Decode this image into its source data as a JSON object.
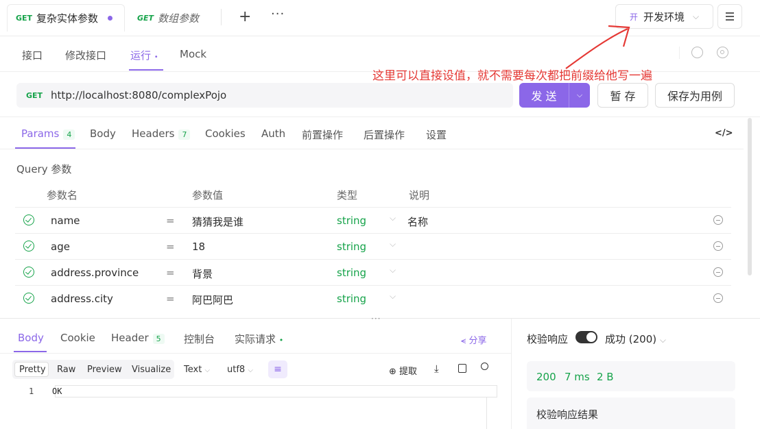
{
  "tabs": [
    {
      "method": "GET",
      "label": "复杂实体参数"
    },
    {
      "method": "GET",
      "label": "数组参数"
    }
  ],
  "env": {
    "badge": "开",
    "label": "开发环境"
  },
  "subnav": [
    "接口",
    "修改接口",
    "运行",
    "Mock"
  ],
  "annotation": "这里可以直接设值，就不需要每次都把前缀给他写一遍",
  "request": {
    "method": "GET",
    "url": "http://localhost:8080/complexPojo",
    "send": "发 送",
    "save": "暂 存",
    "save_case": "保存为用例"
  },
  "param_tabs": [
    {
      "label": "Params",
      "count": "4"
    },
    {
      "label": "Body"
    },
    {
      "label": "Headers",
      "count": "7"
    },
    {
      "label": "Cookies"
    },
    {
      "label": "Auth"
    },
    {
      "label": "前置操作"
    },
    {
      "label": "后置操作"
    },
    {
      "label": "设置"
    }
  ],
  "query": {
    "title": "Query 参数",
    "headers": [
      "参数名",
      "参数值",
      "类型",
      "说明"
    ],
    "rows": [
      {
        "name": "name",
        "eq": "=",
        "value": "猜猜我是谁",
        "type": "string",
        "desc": "名称"
      },
      {
        "name": "age",
        "eq": "=",
        "value": "18",
        "type": "string",
        "desc": ""
      },
      {
        "name": "address.province",
        "eq": "=",
        "value": "背景",
        "type": "string",
        "desc": ""
      },
      {
        "name": "address.city",
        "eq": "=",
        "value": "阿巴阿巴",
        "type": "string",
        "desc": ""
      }
    ]
  },
  "response_tabs": [
    {
      "label": "Body"
    },
    {
      "label": "Cookie"
    },
    {
      "label": "Header",
      "count": "5"
    },
    {
      "label": "控制台"
    },
    {
      "label": "实际请求"
    }
  ],
  "share": "分享",
  "view_tabs": [
    "Pretty",
    "Raw",
    "Preview",
    "Visualize"
  ],
  "format": "Text",
  "encoding": "utf8",
  "extract": "提取",
  "code": {
    "line": "1",
    "text": "OK"
  },
  "validate": {
    "label": "校验响应",
    "status": "成功 (200)"
  },
  "stats": {
    "code": "200",
    "time": "7 ms",
    "size": "2 B"
  },
  "result_title": "校验响应结果",
  "colors": {
    "accent": "#8b67e8",
    "green": "#16a34a",
    "annotation": "#e53935"
  }
}
